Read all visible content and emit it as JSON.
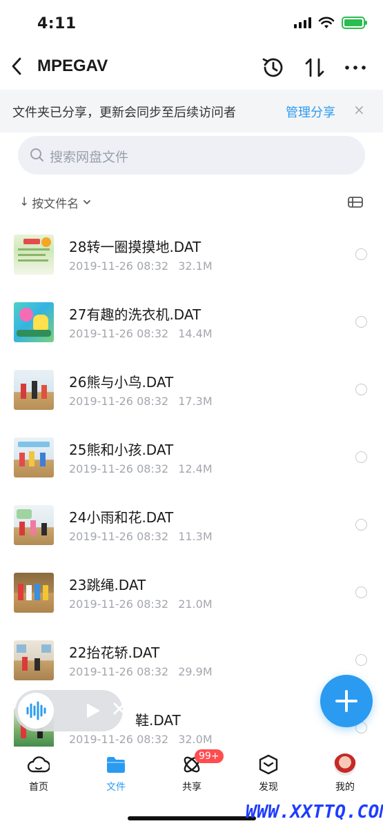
{
  "status_bar": {
    "time": "4:11"
  },
  "nav": {
    "title": "MPEGAV"
  },
  "share_banner": {
    "text": "文件夹已分享，更新会同步至后续访问者",
    "link": "管理分享",
    "close": "×"
  },
  "search": {
    "placeholder": "搜索网盘文件"
  },
  "sort": {
    "arrow": "↓",
    "label": "按文件名",
    "chevron": "⌄"
  },
  "files": [
    {
      "name": "28转一圈摸摸地.DAT",
      "date": "2019-11-26 08:32",
      "size": "32.1M"
    },
    {
      "name": "27有趣的洗衣机.DAT",
      "date": "2019-11-26 08:32",
      "size": "14.4M"
    },
    {
      "name": "26熊与小鸟.DAT",
      "date": "2019-11-26 08:32",
      "size": "17.3M"
    },
    {
      "name": "25熊和小孩.DAT",
      "date": "2019-11-26 08:32",
      "size": "12.4M"
    },
    {
      "name": "24小雨和花.DAT",
      "date": "2019-11-26 08:32",
      "size": "11.3M"
    },
    {
      "name": "23跳绳.DAT",
      "date": "2019-11-26 08:32",
      "size": "21.0M"
    },
    {
      "name": "22抬花轿.DAT",
      "date": "2019-11-26 08:32",
      "size": "29.9M"
    },
    {
      "name": "鞋.DAT",
      "date": "2019-11-26 08:32",
      "size": "32.0M"
    }
  ],
  "tabs": [
    {
      "label": "首页",
      "icon": "cloud-home-icon"
    },
    {
      "label": "文件",
      "icon": "folder-icon"
    },
    {
      "label": "共享",
      "icon": "atom-share-icon",
      "badge": "99+"
    },
    {
      "label": "发现",
      "icon": "box-discover-icon"
    },
    {
      "label": "我的",
      "icon": "avatar"
    }
  ],
  "watermark": "WWW.XXTTQ.COM",
  "colors": {
    "accent": "#2a9bf0",
    "badge": "#ff4d4f",
    "battery": "#2bbd4f"
  }
}
